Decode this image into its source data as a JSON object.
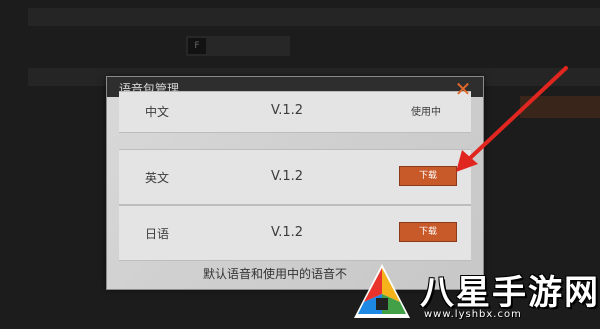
{
  "dialog": {
    "title": "语音包管理",
    "close_glyph": "✕",
    "rows": [
      {
        "language": "中文",
        "version": "V.1.2",
        "status": "使用中"
      },
      {
        "language": "英文",
        "version": "V.1.2",
        "button": "下载"
      },
      {
        "language": "日语",
        "version": "V.1.2",
        "button": "下载"
      }
    ],
    "footer_note": "默认语音和使用中的语音不"
  },
  "colors": {
    "accent_orange": "#c85a2a",
    "close_orange": "#e0692b",
    "arrow_red": "#e0261f"
  },
  "background": {
    "control_key": "F"
  },
  "watermark": {
    "text": "八星手游网",
    "url": "www.lyshbx.com"
  }
}
